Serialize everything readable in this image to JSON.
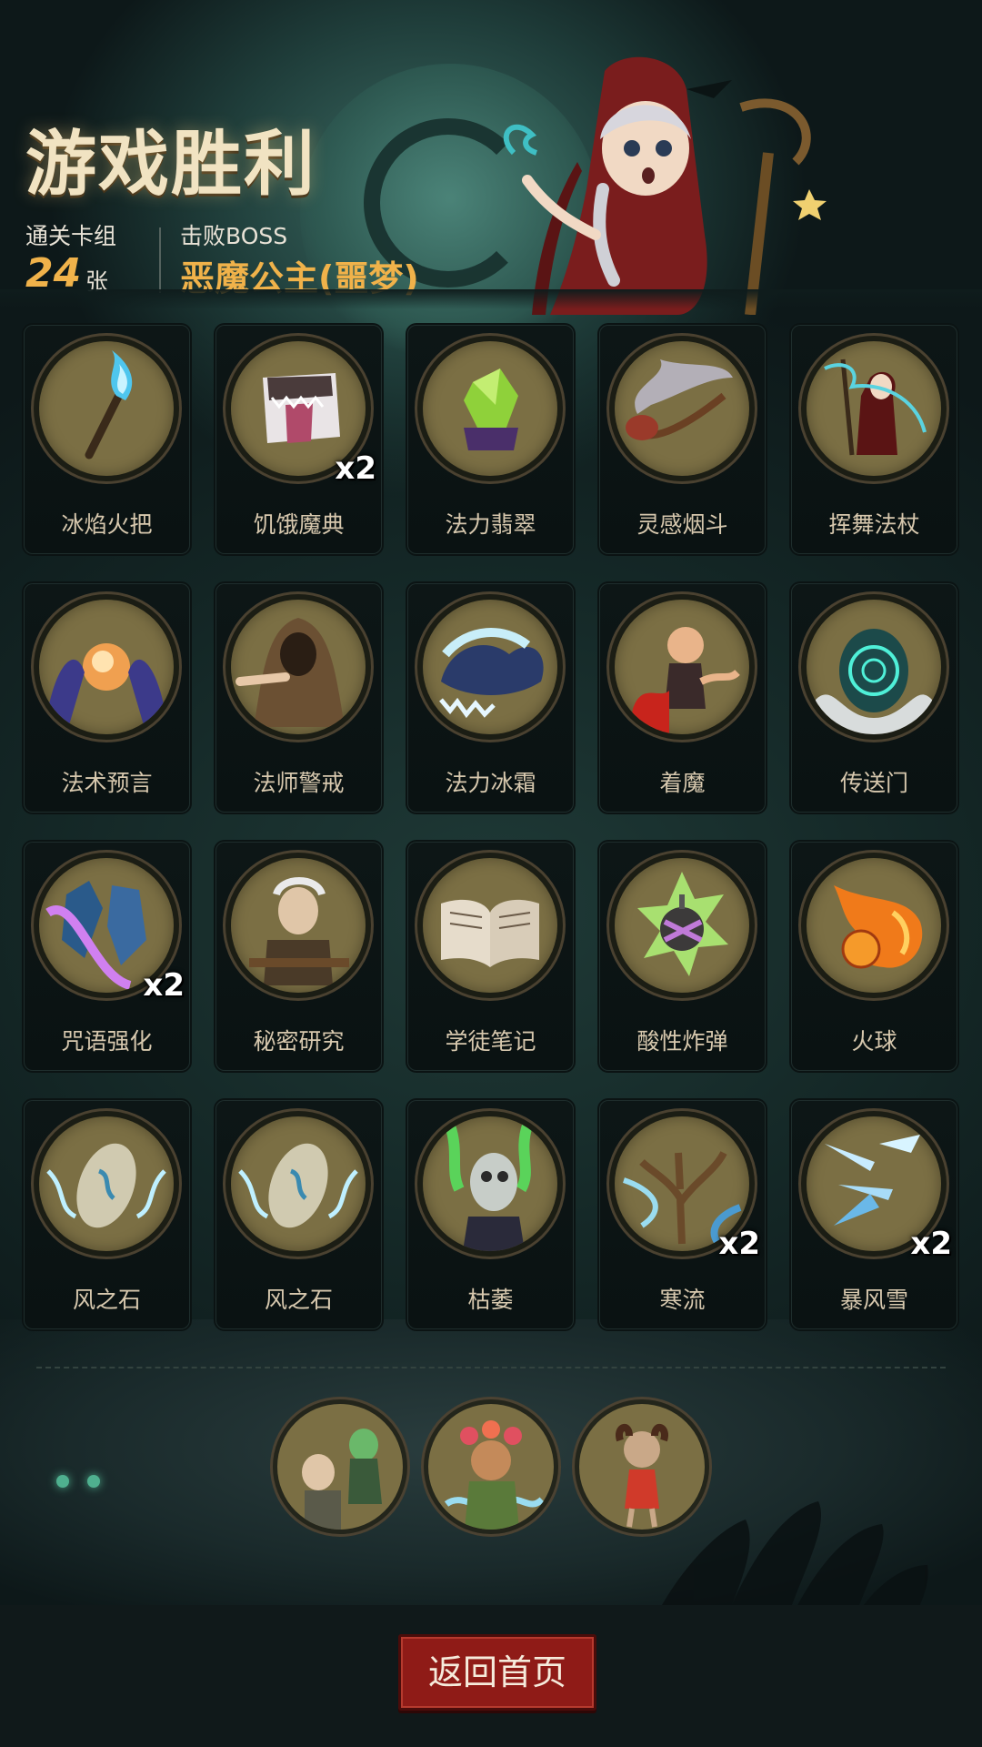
{
  "header": {
    "title": "游戏胜利",
    "deck_label": "通关卡组",
    "deck_count": "24",
    "deck_unit": "张",
    "boss_label": "击败BOSS",
    "boss_name": "恶魔公主(噩梦)"
  },
  "cards": [
    {
      "name": "冰焰火把",
      "count": "",
      "icon": "ice-flame-torch"
    },
    {
      "name": "饥饿魔典",
      "count": "x2",
      "icon": "hungry-grimoire"
    },
    {
      "name": "法力翡翠",
      "count": "",
      "icon": "mana-emerald"
    },
    {
      "name": "灵感烟斗",
      "count": "",
      "icon": "inspiration-pipe"
    },
    {
      "name": "挥舞法杖",
      "count": "",
      "icon": "staff-wielder"
    },
    {
      "name": "法术预言",
      "count": "",
      "icon": "crystal-ball"
    },
    {
      "name": "法师警戒",
      "count": "",
      "icon": "hooded-mage"
    },
    {
      "name": "法力冰霜",
      "count": "",
      "icon": "frost-hands"
    },
    {
      "name": "着魔",
      "count": "",
      "icon": "possessed-man"
    },
    {
      "name": "传送门",
      "count": "",
      "icon": "portal"
    },
    {
      "name": "咒语强化",
      "count": "x2",
      "icon": "rune-crystals"
    },
    {
      "name": "秘密研究",
      "count": "",
      "icon": "old-scholar"
    },
    {
      "name": "学徒笔记",
      "count": "",
      "icon": "open-book"
    },
    {
      "name": "酸性炸弹",
      "count": "",
      "icon": "acid-bomb"
    },
    {
      "name": "火球",
      "count": "",
      "icon": "fireball"
    },
    {
      "name": "风之石",
      "count": "",
      "icon": "wind-stone"
    },
    {
      "name": "风之石",
      "count": "",
      "icon": "wind-stone"
    },
    {
      "name": "枯萎",
      "count": "",
      "icon": "withered-ghoul"
    },
    {
      "name": "寒流",
      "count": "x2",
      "icon": "cold-wave-tree"
    },
    {
      "name": "暴风雪",
      "count": "x2",
      "icon": "ice-shards"
    }
  ],
  "relics": [
    {
      "icon": "zombie-reader"
    },
    {
      "icon": "flower-dryad"
    },
    {
      "icon": "voodoo-doll"
    }
  ],
  "footer": {
    "home_button": "返回首页"
  },
  "colors": {
    "accent_gold": "#f0b24a",
    "card_bg": "#0b1414",
    "medallion": "#7b6f44",
    "button_red": "#8f1b17"
  }
}
